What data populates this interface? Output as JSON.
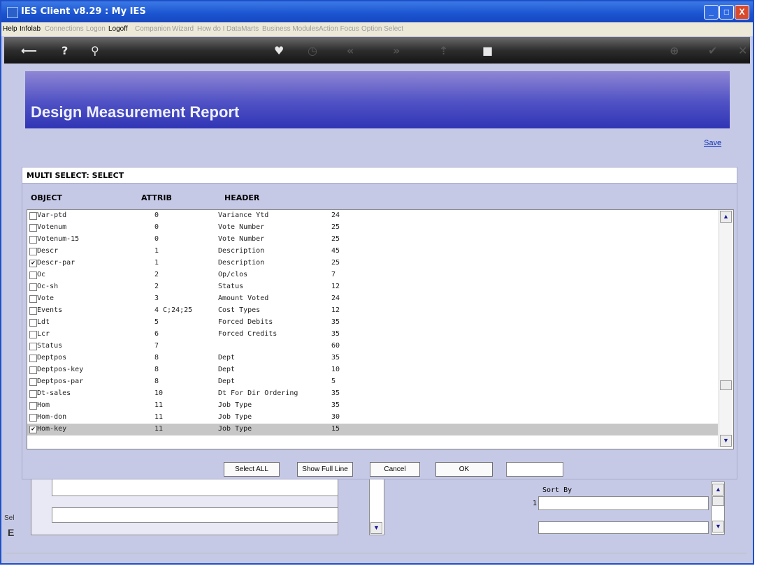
{
  "window": {
    "title": "IES Client v8.29 : My IES",
    "minimize": "_",
    "maximize": "□",
    "close": "X"
  },
  "menu": [
    {
      "label": "Help",
      "enabled": true
    },
    {
      "label": "Infolab",
      "enabled": true
    },
    {
      "label": "Connections",
      "enabled": false
    },
    {
      "label": "Logon",
      "enabled": false
    },
    {
      "label": "Logoff",
      "enabled": true
    },
    {
      "label": "Companion",
      "enabled": false
    },
    {
      "label": "Wizard",
      "enabled": false
    },
    {
      "label": "How do I",
      "enabled": false
    },
    {
      "label": "DataMarts",
      "enabled": false
    },
    {
      "label": "Business Modules",
      "enabled": false
    },
    {
      "label": "Action Focus",
      "enabled": false
    },
    {
      "label": "Option Select",
      "enabled": false
    }
  ],
  "toolbar_icons": [
    "back-icon",
    "help-icon",
    "search-icon",
    "heart-icon",
    "clock-icon",
    "rewind-icon",
    "forward-icon",
    "upload-icon",
    "stop-icon",
    "add-icon",
    "check-icon",
    "close-icon"
  ],
  "page": {
    "title": "Design Measurement Report",
    "save_link": "Save"
  },
  "dialog": {
    "title": "MULTI SELECT: SELECT",
    "columns": {
      "object": "OBJECT",
      "attrib": "ATTRIB",
      "header": "HEADER"
    },
    "rows": [
      {
        "object": "Var-ptd",
        "attrib": "0",
        "header": "Variance Ytd",
        "width": "24",
        "checked": false
      },
      {
        "object": "Votenum",
        "attrib": "0",
        "header": "Vote Number",
        "width": "25",
        "checked": false
      },
      {
        "object": "Votenum-15",
        "attrib": "0",
        "header": "Vote Number",
        "width": "25",
        "checked": false
      },
      {
        "object": "Descr",
        "attrib": "1",
        "header": "Description",
        "width": "45",
        "checked": false
      },
      {
        "object": "Descr-par",
        "attrib": "1",
        "header": "Description",
        "width": "25",
        "checked": true
      },
      {
        "object": "Oc",
        "attrib": "2",
        "header": "Op/clos",
        "width": "7",
        "checked": false
      },
      {
        "object": "Oc-sh",
        "attrib": "2",
        "header": "Status",
        "width": "12",
        "checked": false
      },
      {
        "object": "Vote",
        "attrib": "3",
        "header": "Amount Voted",
        "width": "24",
        "checked": false
      },
      {
        "object": "Events",
        "attrib": "4 C;24;25",
        "header": "Cost Types",
        "width": "12",
        "checked": false
      },
      {
        "object": "Ldt",
        "attrib": "5",
        "header": "Forced Debits",
        "width": "35",
        "checked": false
      },
      {
        "object": "Lcr",
        "attrib": "6",
        "header": "Forced Credits",
        "width": "35",
        "checked": false
      },
      {
        "object": "Status",
        "attrib": "7",
        "header": "",
        "width": "60",
        "checked": false
      },
      {
        "object": "Deptpos",
        "attrib": "8",
        "header": "Dept",
        "width": "35",
        "checked": false
      },
      {
        "object": "Deptpos-key",
        "attrib": "8",
        "header": "Dept",
        "width": "10",
        "checked": false
      },
      {
        "object": "Deptpos-par",
        "attrib": "8",
        "header": "Dept",
        "width": "5",
        "checked": false
      },
      {
        "object": "Dt-sales",
        "attrib": "10",
        "header": "Dt For Dir Ordering",
        "width": "35",
        "checked": false
      },
      {
        "object": "Hom",
        "attrib": "11",
        "header": "Job Type",
        "width": "35",
        "checked": false
      },
      {
        "object": "Hom-don",
        "attrib": "11",
        "header": "Job Type",
        "width": "30",
        "checked": false
      },
      {
        "object": "Hom-key",
        "attrib": "11",
        "header": "Job Type",
        "width": "15",
        "checked": true,
        "selected": true
      }
    ],
    "buttons": {
      "select_all": "Select ALL",
      "show_full_line": "Show Full Line",
      "cancel": "Cancel",
      "ok": "OK"
    },
    "input_value": ""
  },
  "background": {
    "sort_by": "Sort By",
    "sort_row": "1",
    "side_label_a": "Sel",
    "side_label_b": "E"
  }
}
